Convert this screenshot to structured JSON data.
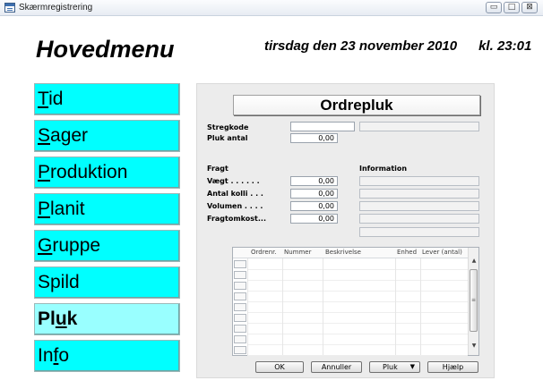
{
  "window": {
    "title": "Skærmregistrering",
    "controls": [
      "▭",
      "□",
      "⊠"
    ]
  },
  "header": {
    "title": "Hovedmenu",
    "date": "tirsdag den 23 november 2010",
    "time": "kl. 23:01"
  },
  "menu": {
    "items": [
      {
        "pre": "",
        "u": "T",
        "post": "id"
      },
      {
        "pre": "",
        "u": "S",
        "post": "ager"
      },
      {
        "pre": "",
        "u": "P",
        "post": "roduktion"
      },
      {
        "pre": "",
        "u": "P",
        "post": "lanit"
      },
      {
        "pre": "",
        "u": "G",
        "post": "ruppe"
      },
      {
        "pre": "Spild",
        "u": "",
        "post": ""
      },
      {
        "pre": "Pl",
        "u": "u",
        "post": "k"
      },
      {
        "pre": "In",
        "u": "f",
        "post": "o"
      }
    ],
    "active_index": 6
  },
  "panel": {
    "title": "Ordrepluk",
    "stregkode_label": "Stregkode",
    "stregkode_value": "",
    "pluk_antal_label": "Pluk antal",
    "pluk_antal_value": "0,00",
    "fragt_label": "Fragt",
    "information_label": "Information",
    "vaegt_label": "Vægt . . . . . .",
    "vaegt_value": "0,00",
    "antal_kolli_label": "Antal kolli . . .",
    "antal_kolli_value": "0,00",
    "volumen_label": "Volumen . . . .",
    "volumen_value": "0,00",
    "fragtomkost_label": "Fragtomkost...",
    "fragtomkost_value": "0,00"
  },
  "grid": {
    "columns": [
      "Ordrenr.",
      "Nummer",
      "Beskrivelse",
      "Enhed",
      "Lever (antal)"
    ],
    "row_count": 9
  },
  "buttons": {
    "ok": "OK",
    "annuller": "Annuller",
    "pluk": "Pluk",
    "hjaelp": "Hjælp"
  }
}
